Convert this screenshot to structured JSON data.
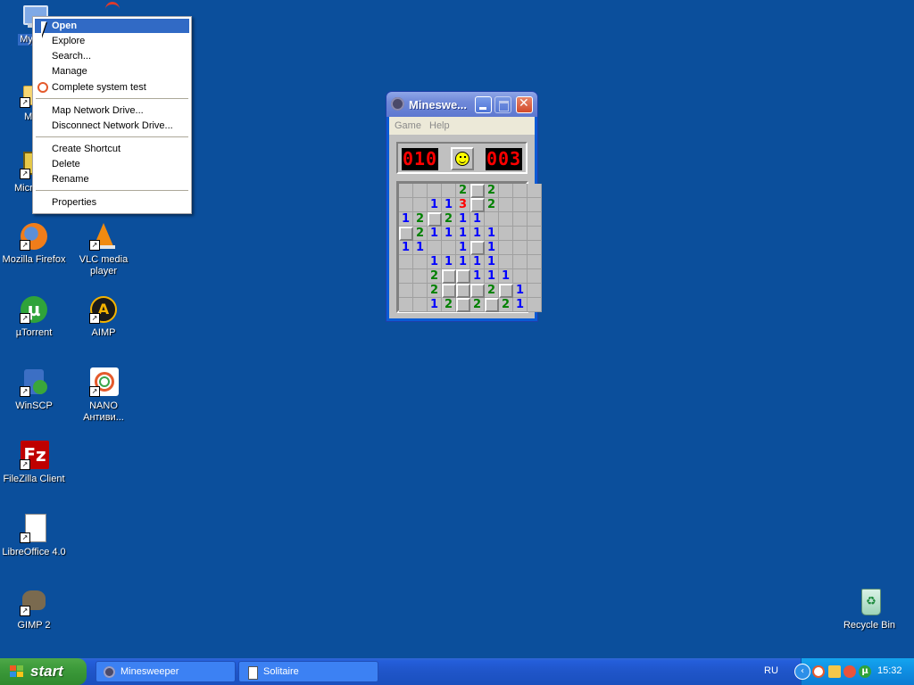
{
  "desktop": {
    "icons": [
      {
        "label": "My Co"
      },
      {
        "label": "MyP"
      },
      {
        "label": "Micr Outl"
      },
      {
        "label": "Mozilla Firefox"
      },
      {
        "label": "VLC media player"
      },
      {
        "label": "µTorrent"
      },
      {
        "label": "AIMP"
      },
      {
        "label": "WinSCP"
      },
      {
        "label": "NANO Антиви..."
      },
      {
        "label": "FileZilla Client"
      },
      {
        "label": "LibreOffice 4.0"
      },
      {
        "label": "GIMP 2"
      },
      {
        "label": "Recycle Bin"
      }
    ]
  },
  "context_menu": {
    "items": [
      "Open",
      "Explore",
      "Search...",
      "Manage",
      "Complete system test",
      "Map Network Drive...",
      "Disconnect Network Drive...",
      "Create Shortcut",
      "Delete",
      "Rename",
      "Properties"
    ],
    "selected": "Open"
  },
  "minesweeper": {
    "title": "Mineswe...",
    "menu": [
      "Game",
      "Help"
    ],
    "mines_counter": "010",
    "timer": "003",
    "colors": {
      "1": "#0000ff",
      "2": "#008000",
      "3": "#ff0000"
    },
    "grid": [
      "...0 2c2...",
      "..11 3c2...",
      "12c2 11....",
      "c211 111...",
      "11.. 1c1...",
      "..11 111...",
      "..2c c111..",
      "..2c cc2c1.",
      "..12 c2c21."
    ]
  },
  "taskbar": {
    "start_label": "start",
    "buttons": [
      "Minesweeper",
      "Solitaire"
    ],
    "language": "RU",
    "clock": "15:32"
  }
}
